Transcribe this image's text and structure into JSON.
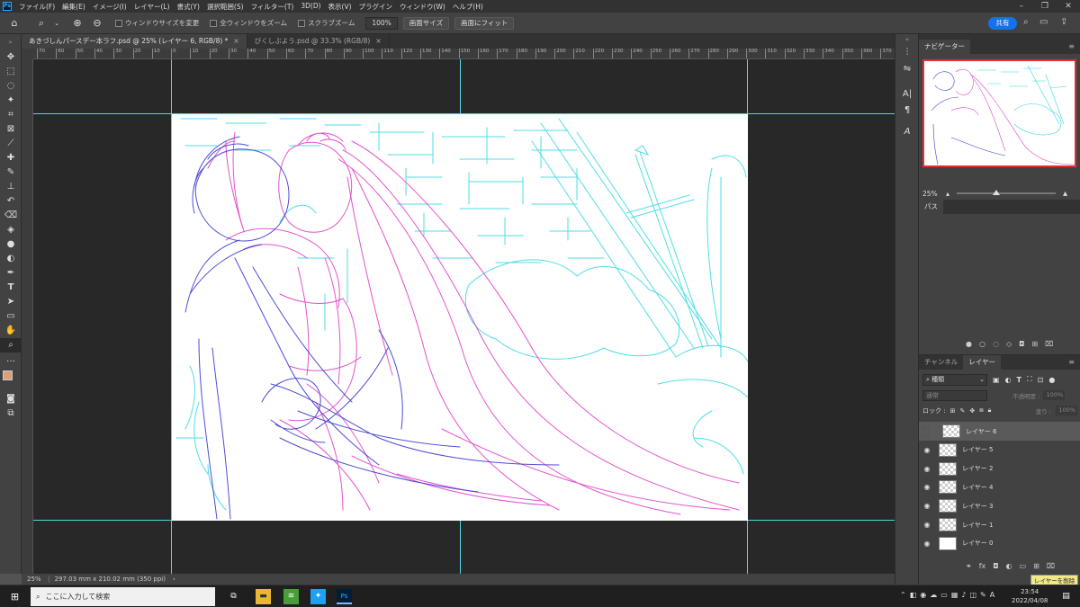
{
  "app": {
    "logo": "Ps"
  },
  "menu": [
    "ファイル(F)",
    "編集(E)",
    "イメージ(I)",
    "レイヤー(L)",
    "書式(Y)",
    "選択範囲(S)",
    "フィルター(T)",
    "3D(D)",
    "表示(V)",
    "プラグイン",
    "ウィンドウ(W)",
    "ヘルプ(H)"
  ],
  "options": {
    "chk_resize": "ウィンドウサイズを変更",
    "chk_all_windows": "全ウィンドウをズーム",
    "chk_scrubby": "スクラブズーム",
    "zoom_value": "100%",
    "btn_screen_size": "画面サイズ",
    "btn_fit_screen": "画面にフィット",
    "share": "共有"
  },
  "tabs": [
    {
      "label": "あきづしんパースデー本ラフ.psd @ 25% (レイヤー 6, RGB/8) *",
      "active": true
    },
    {
      "label": "びくしぶよう.psd @ 33.3% (RGB/8)",
      "active": false
    }
  ],
  "ruler_ticks": [
    "70",
    "60",
    "50",
    "40",
    "30",
    "20",
    "10",
    "0",
    "10",
    "20",
    "30",
    "40",
    "50",
    "60",
    "70",
    "80",
    "90",
    "100",
    "110",
    "120",
    "130",
    "140",
    "150",
    "160",
    "170",
    "180",
    "190",
    "200",
    "210",
    "220",
    "230",
    "240",
    "250",
    "260",
    "270",
    "280",
    "290",
    "300",
    "310",
    "320",
    "330",
    "340",
    "350",
    "360",
    "370"
  ],
  "status": {
    "zoom": "25%",
    "doc_info": "297.03 mm x 210.02 mm (350 ppi)"
  },
  "panels": {
    "navigator": {
      "tab": "ナビゲーター",
      "zoom": "25%",
      "zoom_level": 0.4
    },
    "paths": {
      "tab": "パス"
    },
    "channels_tab": "チャンネル",
    "layers_tab": "レイヤー",
    "kind_filter": "種類",
    "blend_mode": "通常",
    "opacity_label": "不透明度 :",
    "opacity_value": "100%",
    "lock_label": "ロック :",
    "fill_label": "塗り :",
    "fill_value": "100%",
    "layers": [
      {
        "name": "レイヤー 6",
        "visible": false,
        "selected": true,
        "thumb": "transparent"
      },
      {
        "name": "レイヤー 5",
        "visible": true,
        "selected": false,
        "thumb": "transparent"
      },
      {
        "name": "レイヤー 2",
        "visible": true,
        "selected": false,
        "thumb": "transparent"
      },
      {
        "name": "レイヤー 4",
        "visible": true,
        "selected": false,
        "thumb": "transparent"
      },
      {
        "name": "レイヤー 3",
        "visible": true,
        "selected": false,
        "thumb": "transparent"
      },
      {
        "name": "レイヤー 1",
        "visible": true,
        "selected": false,
        "thumb": "transparent"
      },
      {
        "name": "レイヤー 0",
        "visible": true,
        "selected": false,
        "thumb": "white"
      }
    ],
    "tooltip": "レイヤーを削除"
  },
  "taskbar": {
    "search_placeholder": "ここに入力して検索",
    "time": "23:54",
    "date": "2022/04/08",
    "ime": "A"
  },
  "colors": {
    "guide": "#4fd6e6",
    "sketch_pink": "#e040c8",
    "sketch_blue": "#3a3ad0",
    "sketch_cyan": "#30d8e0",
    "accent": "#1473e6"
  }
}
